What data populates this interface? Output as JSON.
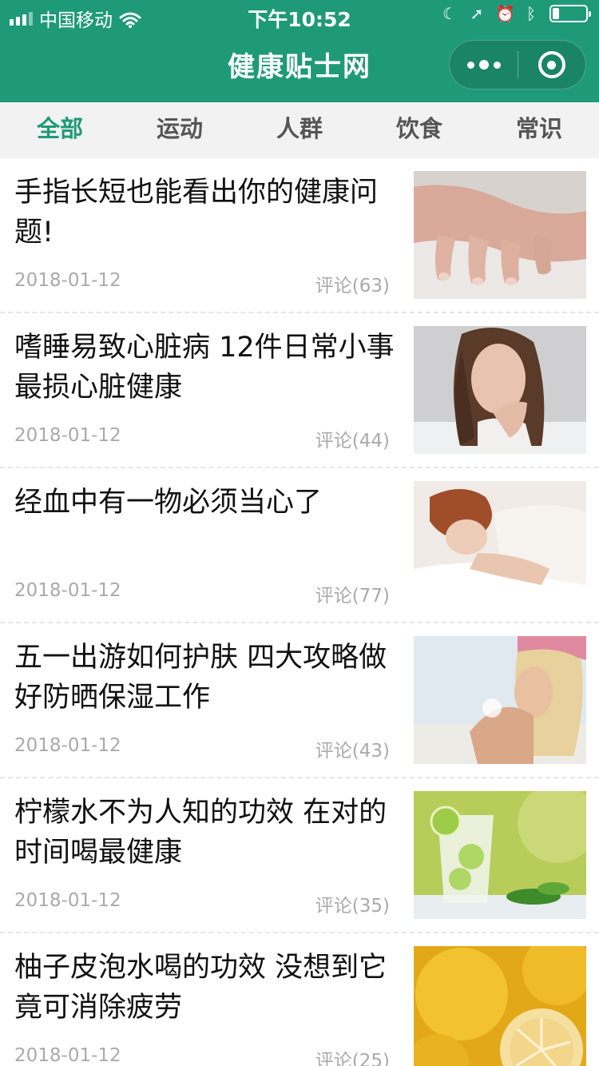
{
  "status_bar": {
    "carrier": "中国移动",
    "time": "下午10:52"
  },
  "nav": {
    "title": "健康贴士网"
  },
  "tabs": [
    {
      "label": "全部",
      "active": true
    },
    {
      "label": "运动",
      "active": false
    },
    {
      "label": "人群",
      "active": false
    },
    {
      "label": "饮食",
      "active": false
    },
    {
      "label": "常识",
      "active": false
    }
  ],
  "articles": [
    {
      "title": "手指长短也能看出你的健康问题!",
      "date": "2018-01-12",
      "comments": "评论(63)",
      "thumb": "hand-photo"
    },
    {
      "title": "嗜睡易致心脏病 12件日常小事最损心脏健康",
      "date": "2018-01-12",
      "comments": "评论(44)",
      "thumb": "woman-toothache-photo"
    },
    {
      "title": "经血中有一物必须当心了",
      "date": "2018-01-12",
      "comments": "评论(77)",
      "thumb": "sleeping-woman-photo"
    },
    {
      "title": "五一出游如何护肤 四大攻略做好防晒保湿工作",
      "date": "2018-01-12",
      "comments": "评论(43)",
      "thumb": "sunscreen-woman-photo"
    },
    {
      "title": "柠檬水不为人知的功效 在对的时间喝最健康",
      "date": "2018-01-12",
      "comments": "评论(35)",
      "thumb": "lemon-water-photo"
    },
    {
      "title": "柚子皮泡水喝的功效 没想到它竟可消除疲劳",
      "date": "2018-01-12",
      "comments": "评论(25)",
      "thumb": "grapefruit-photo"
    }
  ],
  "colors": {
    "brand": "#1f9a78",
    "tab_bg": "#f2f2f2",
    "meta_text": "#aaaaaa"
  }
}
